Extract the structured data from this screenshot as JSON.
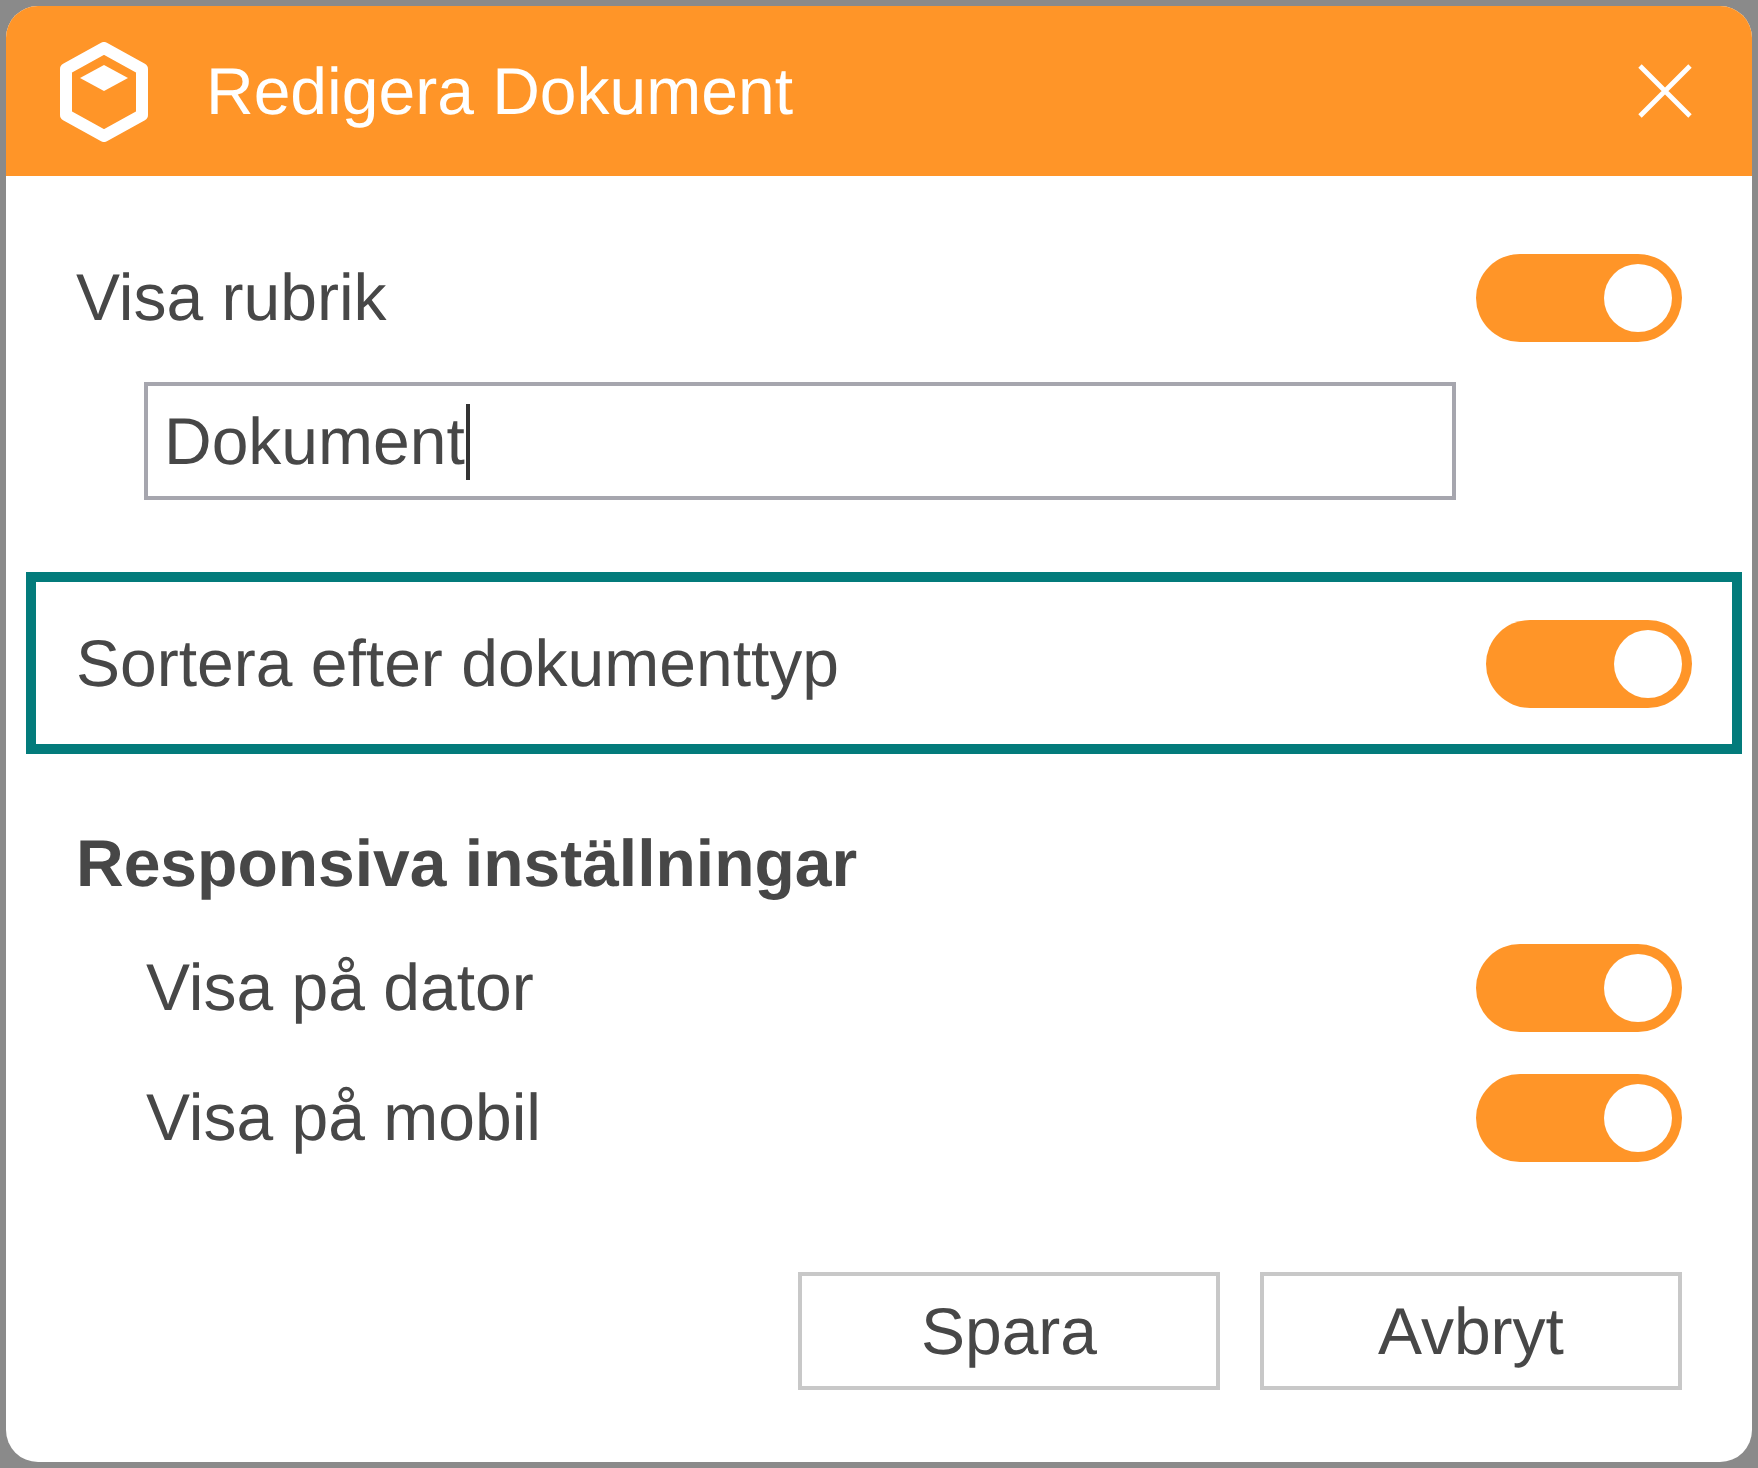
{
  "dialog": {
    "title": "Redigera Dokument"
  },
  "title_setting": {
    "label": "Visa rubrik",
    "on": true,
    "field": {
      "value": "Dokument",
      "focused": true
    }
  },
  "sort_setting": {
    "label": "Sortera efter dokumenttyp",
    "on": true,
    "focused": true
  },
  "responsive": {
    "heading": "Responsiva inställningar",
    "items": [
      {
        "label": "Visa på dator",
        "on": true
      },
      {
        "label": "Visa på mobil",
        "on": true
      }
    ]
  },
  "buttons": [
    "Spara",
    "Avbryt"
  ]
}
